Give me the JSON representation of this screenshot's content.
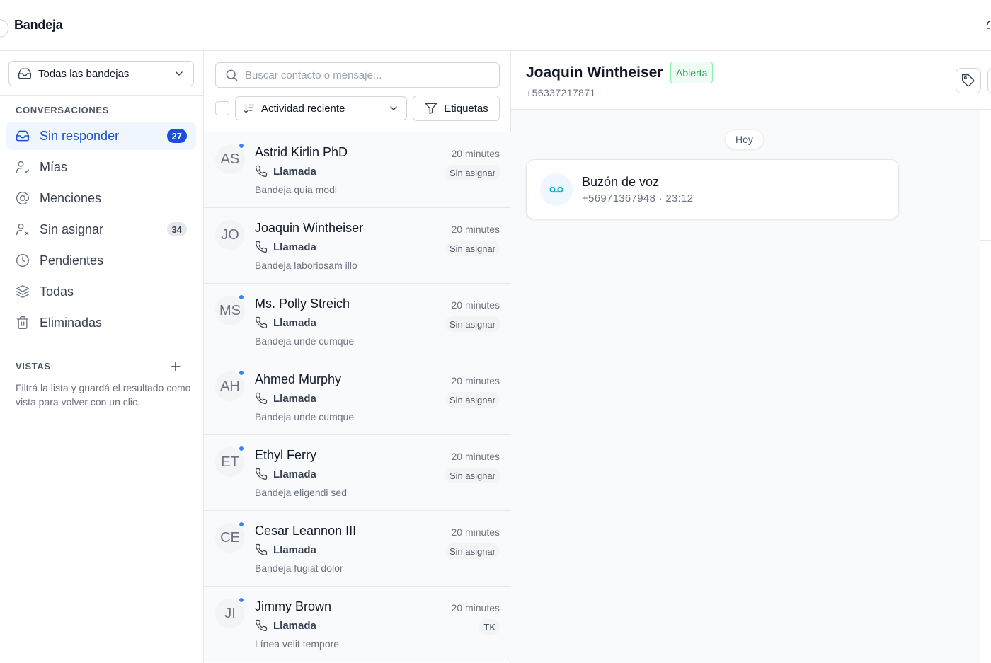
{
  "app": {
    "title": "Bandeja"
  },
  "sidebar": {
    "inbox_selector": "Todas las bandejas",
    "conversations_title": "CONVERSACIONES",
    "items": [
      {
        "label": "Sin responder",
        "icon": "inbox-icon",
        "badge": "27",
        "active": true
      },
      {
        "label": "Mías",
        "icon": "user-check-icon",
        "badge": null,
        "active": false
      },
      {
        "label": "Menciones",
        "icon": "at-sign-icon",
        "badge": null,
        "active": false
      },
      {
        "label": "Sin asignar",
        "icon": "user-x-icon",
        "badge": "34",
        "active": false
      },
      {
        "label": "Pendientes",
        "icon": "clock-icon",
        "badge": null,
        "active": false
      },
      {
        "label": "Todas",
        "icon": "layers-icon",
        "badge": null,
        "active": false
      },
      {
        "label": "Eliminadas",
        "icon": "trash-icon",
        "badge": null,
        "active": false
      }
    ],
    "views_title": "VISTAS",
    "views_help": "Filtrá la lista y guardá el resultado como vista para volver con un clic."
  },
  "list": {
    "search_placeholder": "Buscar contacto o mensaje...",
    "sort_label": "Actividad reciente",
    "tags_label": "Etiquetas",
    "conversations": [
      {
        "initials": "AS",
        "name": "Astrid Kirlin PhD",
        "time": "20 minutes",
        "channel": "Llamada",
        "assignee": "Sin asignar",
        "preview": "Bandeja quia modi",
        "unread": true
      },
      {
        "initials": "JO",
        "name": "Joaquin Wintheiser",
        "time": "20 minutes",
        "channel": "Llamada",
        "assignee": "Sin asignar",
        "preview": "Bandeja laboriosam illo",
        "unread": false
      },
      {
        "initials": "MS",
        "name": "Ms. Polly Streich",
        "time": "20 minutes",
        "channel": "Llamada",
        "assignee": "Sin asignar",
        "preview": "Bandeja unde cumque",
        "unread": true
      },
      {
        "initials": "AH",
        "name": "Ahmed Murphy",
        "time": "20 minutes",
        "channel": "Llamada",
        "assignee": "Sin asignar",
        "preview": "Bandeja unde cumque",
        "unread": true
      },
      {
        "initials": "ET",
        "name": "Ethyl Ferry",
        "time": "20 minutes",
        "channel": "Llamada",
        "assignee": "Sin asignar",
        "preview": "Bandeja eligendi sed",
        "unread": true
      },
      {
        "initials": "CE",
        "name": "Cesar Leannon III",
        "time": "20 minutes",
        "channel": "Llamada",
        "assignee": "Sin asignar",
        "preview": "Bandeja fugiat dolor",
        "unread": true
      },
      {
        "initials": "JI",
        "name": "Jimmy Brown",
        "time": "20 minutes",
        "channel": "Llamada",
        "assignee": "TK",
        "preview": "Línea velit tempore",
        "unread": true
      }
    ]
  },
  "chat": {
    "contact_name": "Joaquin Wintheiser",
    "status": "Abierta",
    "contact_phone": "+56337217871",
    "day_label": "Hoy",
    "message": {
      "title": "Buzón de voz",
      "meta": "+56971367948 · 23:12",
      "icon": "voicemail-icon"
    }
  },
  "colors": {
    "accent": "#1d4ed8",
    "unread_dot": "#3b82f6",
    "status_green": "#16a34a"
  }
}
